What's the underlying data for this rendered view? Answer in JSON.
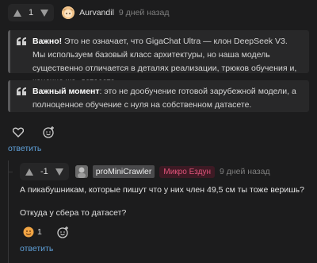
{
  "comment1": {
    "score": "1",
    "author": "Aurvandil",
    "time": "9 дней назад",
    "quote1": {
      "bold": "Важно!",
      "text": " Это не означает, что GigaChat Ultra — клон DeepSeek V3. Мы используем базовый класс архитектуры, но наша модель существенно отличается в деталях реализации, трюков обучения и, конечно же, датасета."
    },
    "quote2": {
      "bold": "Важный момент",
      "text": ": это не дообучение готовой зарубежной модели, а полноценное обучение с нуля на собственном датасете."
    },
    "reply_label": "ответить"
  },
  "comment2": {
    "score": "-1",
    "author": "proMiniCrawler",
    "badge": "Микро Ездун",
    "time": "9 дней назад",
    "line1": "А пикабушникам, которые пишут что у них член 49,5 см ты тоже веришь?",
    "line2": "Откуда у сбера то датасет?",
    "reaction_count": "1",
    "reply_label": "ответить"
  },
  "icons": {
    "up": "arrow-up-icon",
    "down": "arrow-down-icon",
    "heart": "heart-icon",
    "reaction": "emoji-add-icon",
    "quote": "quote-icon"
  },
  "colors": {
    "background": "#1c1c1d",
    "link": "#5fa0d9",
    "badge": "#e0537a"
  }
}
